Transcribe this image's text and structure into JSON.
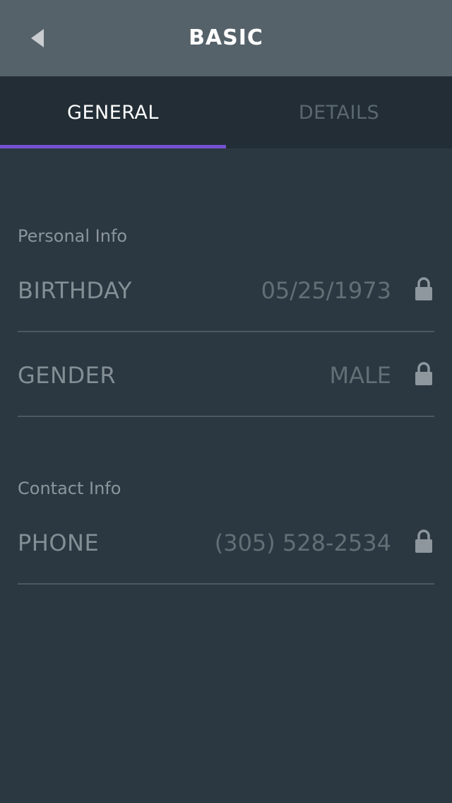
{
  "header": {
    "title": "BASIC",
    "back_icon": "back-arrow-icon"
  },
  "tabs": [
    {
      "label": "GENERAL",
      "active": true
    },
    {
      "label": "DETAILS",
      "active": false
    }
  ],
  "colors": {
    "accent": "#7452d0",
    "header_bg": "#56626a",
    "tabbar_bg": "#222d35",
    "content_bg": "#2c3841"
  },
  "sections": [
    {
      "title": "Personal Info",
      "rows": [
        {
          "label": "BIRTHDAY",
          "value": "05/25/1973",
          "icon": "lock-icon"
        },
        {
          "label": "GENDER",
          "value": "MALE",
          "icon": "lock-icon"
        }
      ]
    },
    {
      "title": "Contact Info",
      "rows": [
        {
          "label": "PHONE",
          "value": "(305) 528-2534",
          "icon": "lock-icon"
        }
      ]
    }
  ]
}
